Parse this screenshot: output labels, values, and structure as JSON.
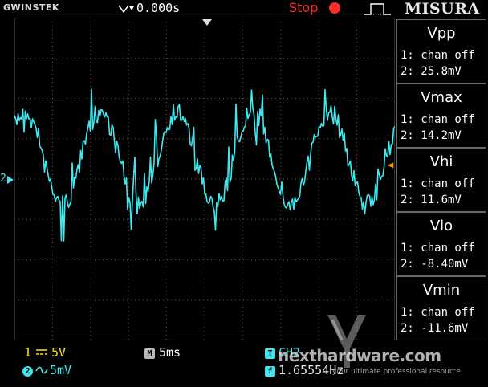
{
  "header": {
    "brand": "GWINSTEK",
    "trigger_position": "0.000s",
    "run_state": "Stop",
    "measure_title": "MISURA"
  },
  "measurements": [
    {
      "name": "Vpp",
      "ch1": "1: chan off",
      "ch2": "2: 25.8mV"
    },
    {
      "name": "Vmax",
      "ch1": "1: chan off",
      "ch2": "2: 14.2mV"
    },
    {
      "name": "Vhi",
      "ch1": "1: chan off",
      "ch2": "2: 11.6mV"
    },
    {
      "name": "Vlo",
      "ch1": "1: chan off",
      "ch2": "2: -8.40mV"
    },
    {
      "name": "Vmin",
      "ch1": "1: chan off",
      "ch2": "2: -11.6mV"
    }
  ],
  "footer": {
    "ch1_badge": "1",
    "ch1_scale": "5V",
    "ch2_badge": "2",
    "ch2_scale": "5mV",
    "timebase_badge": "M",
    "timebase": "5ms",
    "trigger_badge": "T",
    "trigger_source": "CH2",
    "freq_badge": "f",
    "frequency": "1.65554Hz"
  },
  "markers": {
    "ch2_ground": "2",
    "trigger_level": "◀"
  },
  "watermark": {
    "site": "nexthardware.com",
    "tagline": "your ultimate professional resource"
  },
  "colors": {
    "trace_ch2": "#3ee8ef",
    "ch1": "#ffe600",
    "stop": "#ff2a2a",
    "grid": "#5a5a5a",
    "trigger_marker": "#ff9a00"
  }
}
